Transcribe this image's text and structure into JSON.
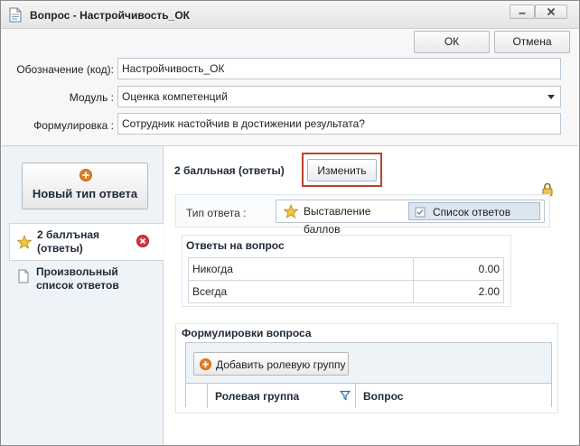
{
  "window": {
    "title": "Вопрос - Настройчивость_ОК",
    "icons": {
      "title": "document-icon",
      "minimize": "minimize-icon",
      "close": "close-icon"
    }
  },
  "toolbar": {
    "ok_label": "ОК",
    "cancel_label": "Отмена"
  },
  "form": {
    "code_label": "Обозначение (код):",
    "code_value": "Настройчивость_ОК",
    "module_label": "Модуль :",
    "module_value": "Оценка компетенций",
    "phrasing_label": "Формулировка :",
    "phrasing_value": "Сотрудник настойчив в достижении результата?"
  },
  "sidebar": {
    "new_type_label": "Новый тип ответа",
    "items": [
      {
        "label_line1": "2 баллъная",
        "label_line2": "(ответы)",
        "icon": "star-icon",
        "selected": true
      },
      {
        "label_line1": "Произвольный",
        "label_line2": "список ответов",
        "icon": "document-icon",
        "selected": false
      }
    ]
  },
  "detail": {
    "title": "2 балльная (ответы)",
    "change_label": "Изменить",
    "answer_type_label": "Тип ответа :",
    "answer_type_options": [
      {
        "label": "Выставление баллов",
        "icon": "star-icon",
        "selected": false
      },
      {
        "label": "Список ответов",
        "icon": "checkbox-icon",
        "selected": true
      }
    ],
    "answers_title": "Ответы на вопрос",
    "answers": [
      {
        "text": "Никогда",
        "value": "0.00"
      },
      {
        "text": "Всегда",
        "value": "2.00"
      }
    ],
    "phrasings_title": "Формулировки вопроса",
    "add_group_label": "Добавить ролевую группу",
    "columns": [
      "Ролевая группа",
      "Вопрос"
    ]
  },
  "colors": {
    "accent_highlight": "#b8442f",
    "selection": "#dce6f0",
    "sidebar_bg": "#eef3f8",
    "add_icon": "#e67e22",
    "remove_icon": "#d9363e"
  }
}
